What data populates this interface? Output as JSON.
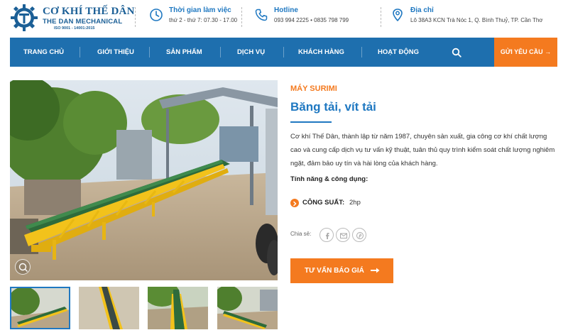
{
  "brand": {
    "name": "CƠ KHÍ THẾ DÂN",
    "subtitle": "THE DAN MECHANICAL",
    "iso": "ISO 9001 - 14001:2015",
    "color": "#1b5f96"
  },
  "header_info": [
    {
      "icon": "clock-icon",
      "title": "Thời gian làm việc",
      "detail": "thứ 2 - thứ 7: 07.30 - 17.00"
    },
    {
      "icon": "phone-icon",
      "title": "Hotline",
      "detail": "093 994 2225 • 0835 798 799"
    },
    {
      "icon": "location-pin-icon",
      "title": "Địa chỉ",
      "detail": "Lô 38A3 KCN Trà Nóc 1, Q. Bình Thuỷ, TP. Cần Thơ"
    }
  ],
  "nav": {
    "items": [
      "TRANG CHỦ",
      "GIỚI THIỆU",
      "SẢN PHẨM",
      "DỊCH VỤ",
      "KHÁCH HÀNG",
      "HOẠT ĐỘNG"
    ],
    "cta": "GỬI YÊU CẦU",
    "bg_color": "#1e6fae",
    "cta_color": "#f47a1f"
  },
  "product": {
    "category": "MÁY SURIMI",
    "title": "Băng tải, vít tải",
    "description": "Cơ khí Thế Dân, thành lập từ năm 1987, chuyên sản xuất, gia công cơ khí chất lượng cao và cung cấp dịch vụ tư vấn kỹ thuật, tuân thủ quy trình kiểm soát chất lượng nghiêm ngặt, đảm bảo uy tín và hài lòng của khách hàng.",
    "features_label": "Tính năng & công dụng:",
    "spec_label": "CÔNG SUẤT:",
    "spec_value": "2hp",
    "share_label": "Chia sẻ:",
    "share_icons": [
      "facebook-icon",
      "email-icon",
      "pinterest-icon"
    ],
    "cta": "TƯ VẤN BÁO GIÁ",
    "accent_color": "#f47a1f",
    "title_color": "#1f78c1"
  },
  "gallery": {
    "thumbnails": 4
  }
}
